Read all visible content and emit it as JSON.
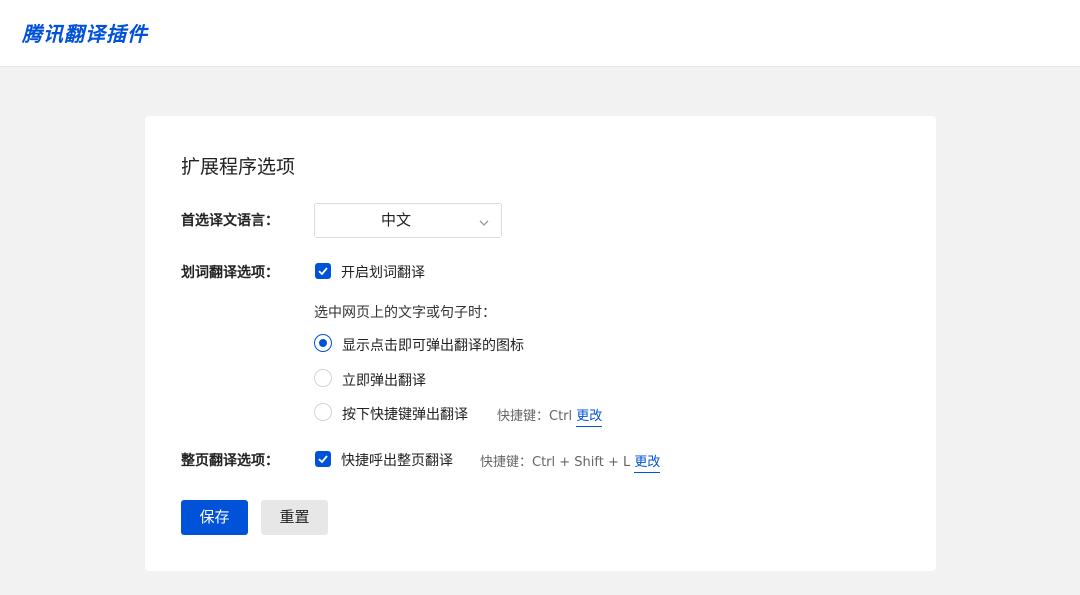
{
  "header": {
    "brand": "腾讯翻译插件"
  },
  "card": {
    "title": "扩展程序选项",
    "language": {
      "label": "首选译文语言：",
      "selected": "中文"
    },
    "selection": {
      "label": "划词翻译选项：",
      "enable_label": "开启划词翻译",
      "enable_checked": true,
      "hint": "选中网页上的文字或句子时：",
      "options": [
        {
          "label": "显示点击即可弹出翻译的图标",
          "selected": true
        },
        {
          "label": "立即弹出翻译",
          "selected": false
        },
        {
          "label": "按下快捷键弹出翻译",
          "selected": false
        }
      ],
      "shortcut_prefix": "快捷键：Ctrl",
      "change_label": "更改"
    },
    "page": {
      "label": "整页翻译选项：",
      "enable_label": "快捷呼出整页翻译",
      "enable_checked": true,
      "shortcut_prefix": "快捷键：Ctrl + Shift + L",
      "change_label": "更改"
    },
    "buttons": {
      "save": "保存",
      "reset": "重置"
    }
  },
  "colors": {
    "accent": "#0052d9",
    "background": "#f2f2f2"
  },
  "icons": {
    "select": "chevron-down-icon",
    "checkbox": "checkmark-icon"
  }
}
